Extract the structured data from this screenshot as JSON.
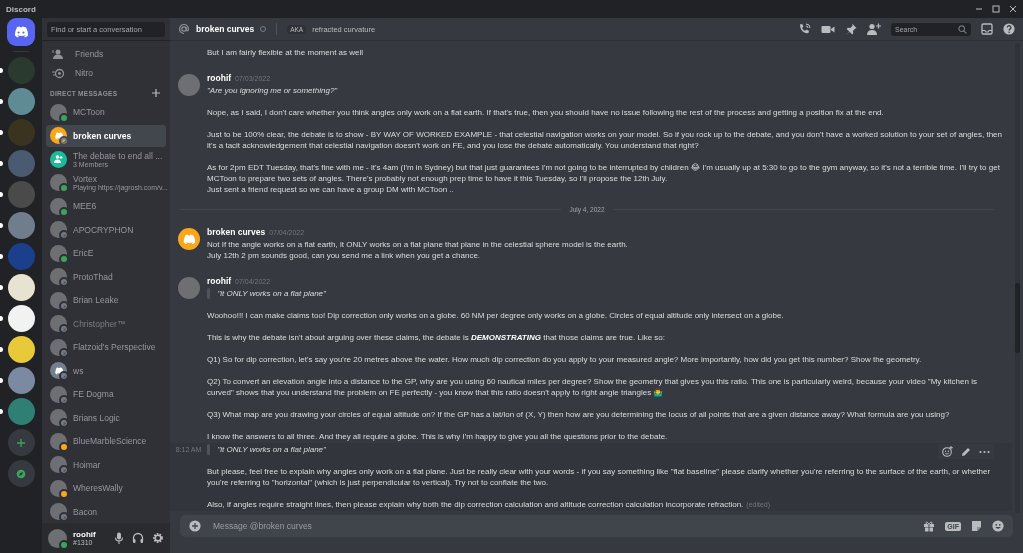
{
  "window": {
    "title": "Discord"
  },
  "servers": [
    {
      "unread": true
    },
    {
      "unread": true
    },
    {
      "unread": true
    },
    {
      "unread": true
    },
    {
      "unread": true
    },
    {
      "unread": true
    },
    {
      "unread": true
    },
    {
      "unread": true
    },
    {
      "unread": true
    },
    {
      "unread": true
    },
    {
      "unread": true
    },
    {
      "unread": true
    }
  ],
  "sidebar": {
    "search_placeholder": "Find or start a conversation",
    "nav": [
      {
        "kind": "friends",
        "label": "Friends"
      },
      {
        "kind": "nitro",
        "label": "Nitro"
      }
    ],
    "section_title": "DIRECT MESSAGES",
    "dms": [
      {
        "name": "MCToon",
        "kind": "photo",
        "color": "#3ba55d",
        "selected": false,
        "dimmed": false
      },
      {
        "name": "broken curves",
        "kind": "default",
        "color": "#747f8d",
        "selected": true,
        "dimmed": false
      },
      {
        "name": "The debate to end all ...",
        "subtitle": "3 Members",
        "kind": "group",
        "selected": false,
        "dimmed": false
      },
      {
        "name": "Vortex",
        "subtitle": "Playing https://jagrosh.com/v...",
        "kind": "photo",
        "color": "#3ba55d",
        "selected": false,
        "dimmed": false
      },
      {
        "name": "MEE6",
        "kind": "photo",
        "color": "#3ba55d",
        "selected": false,
        "dimmed": false
      },
      {
        "name": "APOCRYPHON",
        "kind": "photo",
        "color": "#747f8d",
        "selected": false,
        "dimmed": false
      },
      {
        "name": "EricE",
        "kind": "photo",
        "color": "#3ba55d",
        "selected": false,
        "dimmed": false
      },
      {
        "name": "ProtoThad",
        "kind": "photo",
        "color": "#747f8d",
        "selected": false,
        "dimmed": false
      },
      {
        "name": "Brian Leake",
        "kind": "photo",
        "color": "#747f8d",
        "selected": false,
        "dimmed": false
      },
      {
        "name": "Christopher™",
        "kind": "photo",
        "color": "#747f8d",
        "selected": false,
        "dimmed": true
      },
      {
        "name": "Flatzoid's Perspective",
        "kind": "photo",
        "color": "#747f8d",
        "selected": false,
        "dimmed": false
      },
      {
        "name": "ws",
        "kind": "default",
        "color": "#747f8d",
        "selected": false,
        "dimmed": false
      },
      {
        "name": "FE Dogma",
        "kind": "photo",
        "color": "#747f8d",
        "selected": false,
        "dimmed": false
      },
      {
        "name": "Brians Logic",
        "kind": "photo",
        "color": "#747f8d",
        "selected": false,
        "dimmed": false
      },
      {
        "name": "BlueMarbleScience",
        "kind": "photo",
        "color": "#faa81a",
        "selected": false,
        "dimmed": false
      },
      {
        "name": "Hoimar",
        "kind": "photo",
        "color": "#747f8d",
        "selected": false,
        "dimmed": false
      },
      {
        "name": "WheresWally",
        "kind": "photo",
        "color": "#faa81a",
        "selected": false,
        "dimmed": false
      },
      {
        "name": "Bacon",
        "kind": "photo",
        "color": "#747f8d",
        "selected": false,
        "dimmed": false
      }
    ],
    "user": {
      "name": "roohif",
      "tag": "#1310",
      "color": "#3ba55d"
    }
  },
  "header": {
    "name": "broken curves",
    "aka_tag": "AKA",
    "aka": "refracted curvature",
    "search_placeholder": "Search"
  },
  "messages": [
    {
      "kind": "continuation",
      "hovered": false,
      "paragraphs": [
        {
          "kind": "text",
          "text": "But I am fairly flexible at the moment as well"
        }
      ]
    },
    {
      "kind": "group",
      "author": "roohif",
      "avatar": {
        "kind": "photo"
      },
      "date": "07/03/2022",
      "paragraphs": [
        {
          "kind": "emphasis",
          "text": "\"Are you ignoring me or something?\""
        },
        {
          "kind": "text",
          "text": "Nope, as I said, I don't care whether you think angles only work on a flat earth. If that's true, then you should have no issue following the rest of the process and getting a position fix at the end."
        },
        {
          "kind": "text",
          "text": "Just to be 100% clear, the debate is to show - BY WAY OF WORKED EXAMPLE - that celestial navigation works on your model. So if you rock up to the debate, and you don't have a worked solution to your set of angles, then it's a tacit acknowledgement that celestial navigation doesn't work on FE, and you lose the debate automatically. You understand that right?"
        },
        {
          "kind": "text",
          "text": "As for 2pm EDT Tuesday, that's fine with me - it's 4am (I'm in Sydney) but that just guarantees I'm not going to be interrupted by children 😂 I'm usually up at 5:30 to go to the gym anyway, so it's not a terrible time. I'll try to get MCToon to prepare two sets of angles. There's probably not enough prep time to have it this Tuesday, so I'll propose the 12th July.\nJust sent a friend request so we can have a group DM with MCToon .."
        }
      ]
    },
    {
      "kind": "divider",
      "text": "July 4, 2022"
    },
    {
      "kind": "group",
      "author": "broken curves",
      "avatar": {
        "kind": "default"
      },
      "date": "07/04/2022",
      "paragraphs": [
        {
          "kind": "text",
          "text": "Not If the angle works on a flat earth, it ONLY works on a flat plane that plane in the celestial sphere model is the earth.\nJuly 12th 2 pm sounds good, can you send me a link when you get a chance."
        }
      ]
    },
    {
      "kind": "group",
      "author": "roohif",
      "avatar": {
        "kind": "photo"
      },
      "date": "07/04/2022",
      "paragraphs": [
        {
          "kind": "quote",
          "text": "\"it ONLY works on a flat plane\""
        },
        {
          "kind": "text",
          "text": "Woohoo!!! I can make claims too! Dip correction only works on a globe. 60 NM per degree only works on a globe. Circles of equal altitude only intersect on a globe."
        },
        {
          "kind": "text",
          "text": "This is why the debate isn't about arguing over these claims, the debate is **DEMONSTRATING** that those claims are true. Like so:"
        },
        {
          "kind": "text",
          "text": "Q1) So for dip correction, let's say you're 20 metres above the water. How much dip correction do you apply to your measured angle? More importantly, how did you get this number? Show the geometry."
        },
        {
          "kind": "text",
          "text": "Q2) To convert an elevation angle into a distance to the GP, why are you using 60 nautical miles per degree? Show the geometry that gives you this ratio. This one is particularly weird, because your video \"My kitchen is curved\" shows that you understand the problem on FE perfectly - you know that this ratio doesn't apply to right angle triangles 🤷‍♂️"
        },
        {
          "kind": "text",
          "text": "Q3) What map are you drawing your circles of equal altitude on? If the GP has a lat/lon of (X, Y) then how are you determining the locus of all points that are a given distance away? What formula are you using?"
        },
        {
          "kind": "text",
          "text": "I know the answers to all three. And they all require a globe. This is why I'm happy to give you all the questions prior to the debate."
        }
      ]
    },
    {
      "kind": "continuation",
      "hovered": true,
      "time": "8:12 AM",
      "paragraphs": [
        {
          "kind": "quote",
          "text": "\"it ONLY works on a flat plane\""
        },
        {
          "kind": "text",
          "text": "But please, feel free to explain why angles only work on a flat plane. Just be really clear with your words - if you say something like \"flat baseline\" please clarify whether you're referring to the surface of the earth, or whether you're referring to \"horizontal\" (which is just perpendicular to vertical). Try not to conflate the two."
        },
        {
          "kind": "text",
          "text": "Also, if angles require straight lines, then please explain why both the dip correction calculation and altitude correction calculation incorporate refraction.",
          "edited": "(edited)"
        }
      ]
    }
  ],
  "composer": {
    "placeholder": "Message @broken curves",
    "gif_label": "GIF"
  }
}
